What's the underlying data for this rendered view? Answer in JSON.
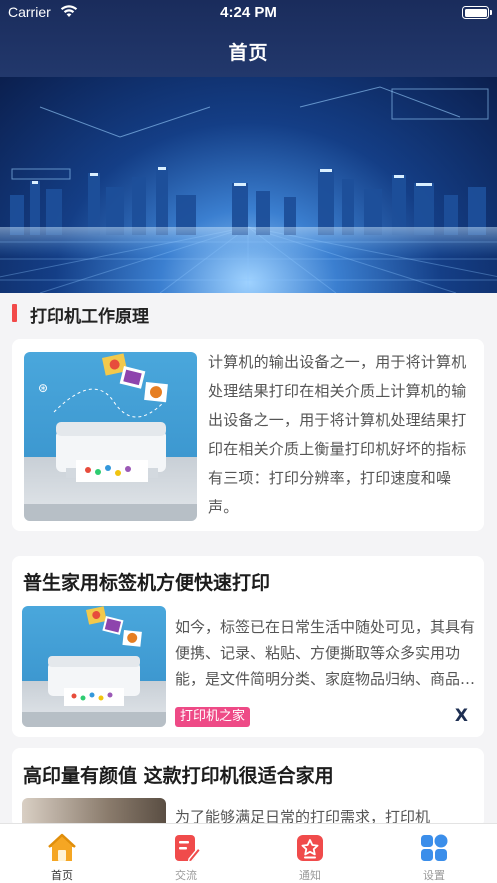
{
  "status_bar": {
    "carrier": "Carrier",
    "time": "4:24 PM"
  },
  "nav": {
    "title": "首页"
  },
  "section": {
    "title": "打印机工作原理"
  },
  "intro": {
    "text": "计算机的输出设备之一，用于将计算机处理结果打印在相关介质上计算机的输出设备之一，用于将计算机处理结果打印在相关介质上衡量打印机好坏的指标有三项：打印分辨率，打印速度和噪声。"
  },
  "news": [
    {
      "title": "普生家用标签机方便快速打印",
      "summary": "如今，标签已在日常生活中随处可见，其具有便携、记录、粘贴、方便撕取等众多实用功能，是文件简明分类、家庭物品归纳、商品信息标注的好帮手。",
      "tag": "打印机之家",
      "close": "X"
    },
    {
      "title": "高印量有颜值 这款打印机很适合家用",
      "summary": "为了能够满足日常的打印需求，打印机"
    }
  ],
  "tabs": [
    {
      "label": "首页",
      "icon": "home-icon",
      "active": true
    },
    {
      "label": "交流",
      "icon": "edit-document-icon",
      "active": false
    },
    {
      "label": "通知",
      "icon": "notification-icon",
      "active": false
    },
    {
      "label": "设置",
      "icon": "settings-grid-icon",
      "active": false
    }
  ],
  "colors": {
    "nav_bg": "#1f3468",
    "accent_red": "#f24a4a",
    "tag_pink": "#ee4a86",
    "home_icon": "#f5a623",
    "exchange_icon": "#f04b4b",
    "notify_icon": "#f04b4b",
    "settings_icon": "#3b8eea"
  }
}
